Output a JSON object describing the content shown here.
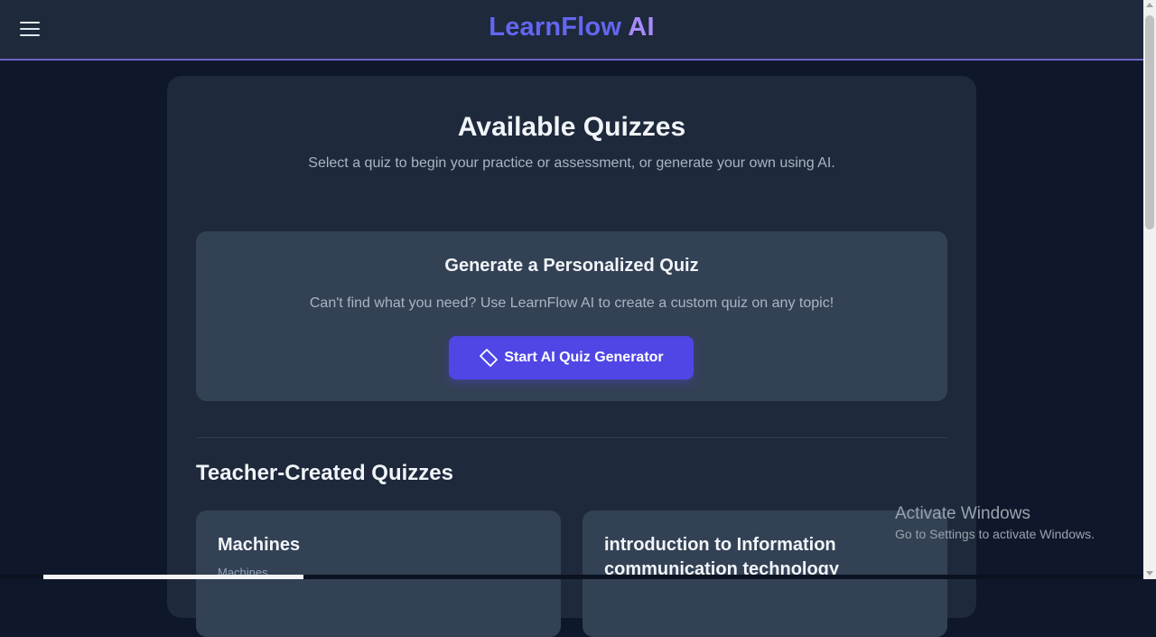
{
  "header": {
    "brand_part1": "LearnFlow",
    "brand_part2": "AI",
    "icons": {
      "menu": "hamburger-menu-icon"
    }
  },
  "main": {
    "title": "Available Quizzes",
    "subtitle": "Select a quiz to begin your practice or assessment, or generate your own using AI.",
    "generator": {
      "title": "Generate a Personalized Quiz",
      "description": "Can't find what you need? Use LearnFlow AI to create a custom quiz on any topic!",
      "button_label": "Start AI Quiz Generator",
      "button_icon": "tag-icon"
    },
    "teacher_section": {
      "title": "Teacher-Created Quizzes",
      "quizzes": [
        {
          "title": "Machines",
          "subtitle": "Machines"
        },
        {
          "title": "introduction to Information communication technology",
          "subtitle": ""
        }
      ]
    }
  },
  "watermark": {
    "title": "Activate Windows",
    "subtitle": "Go to Settings to activate Windows."
  },
  "colors": {
    "background": "#0f172a",
    "surface": "#1e293b",
    "card": "#334155",
    "accent": "#4f46e5",
    "brand_primary": "#6366f1",
    "brand_secondary": "#a78bfa"
  }
}
